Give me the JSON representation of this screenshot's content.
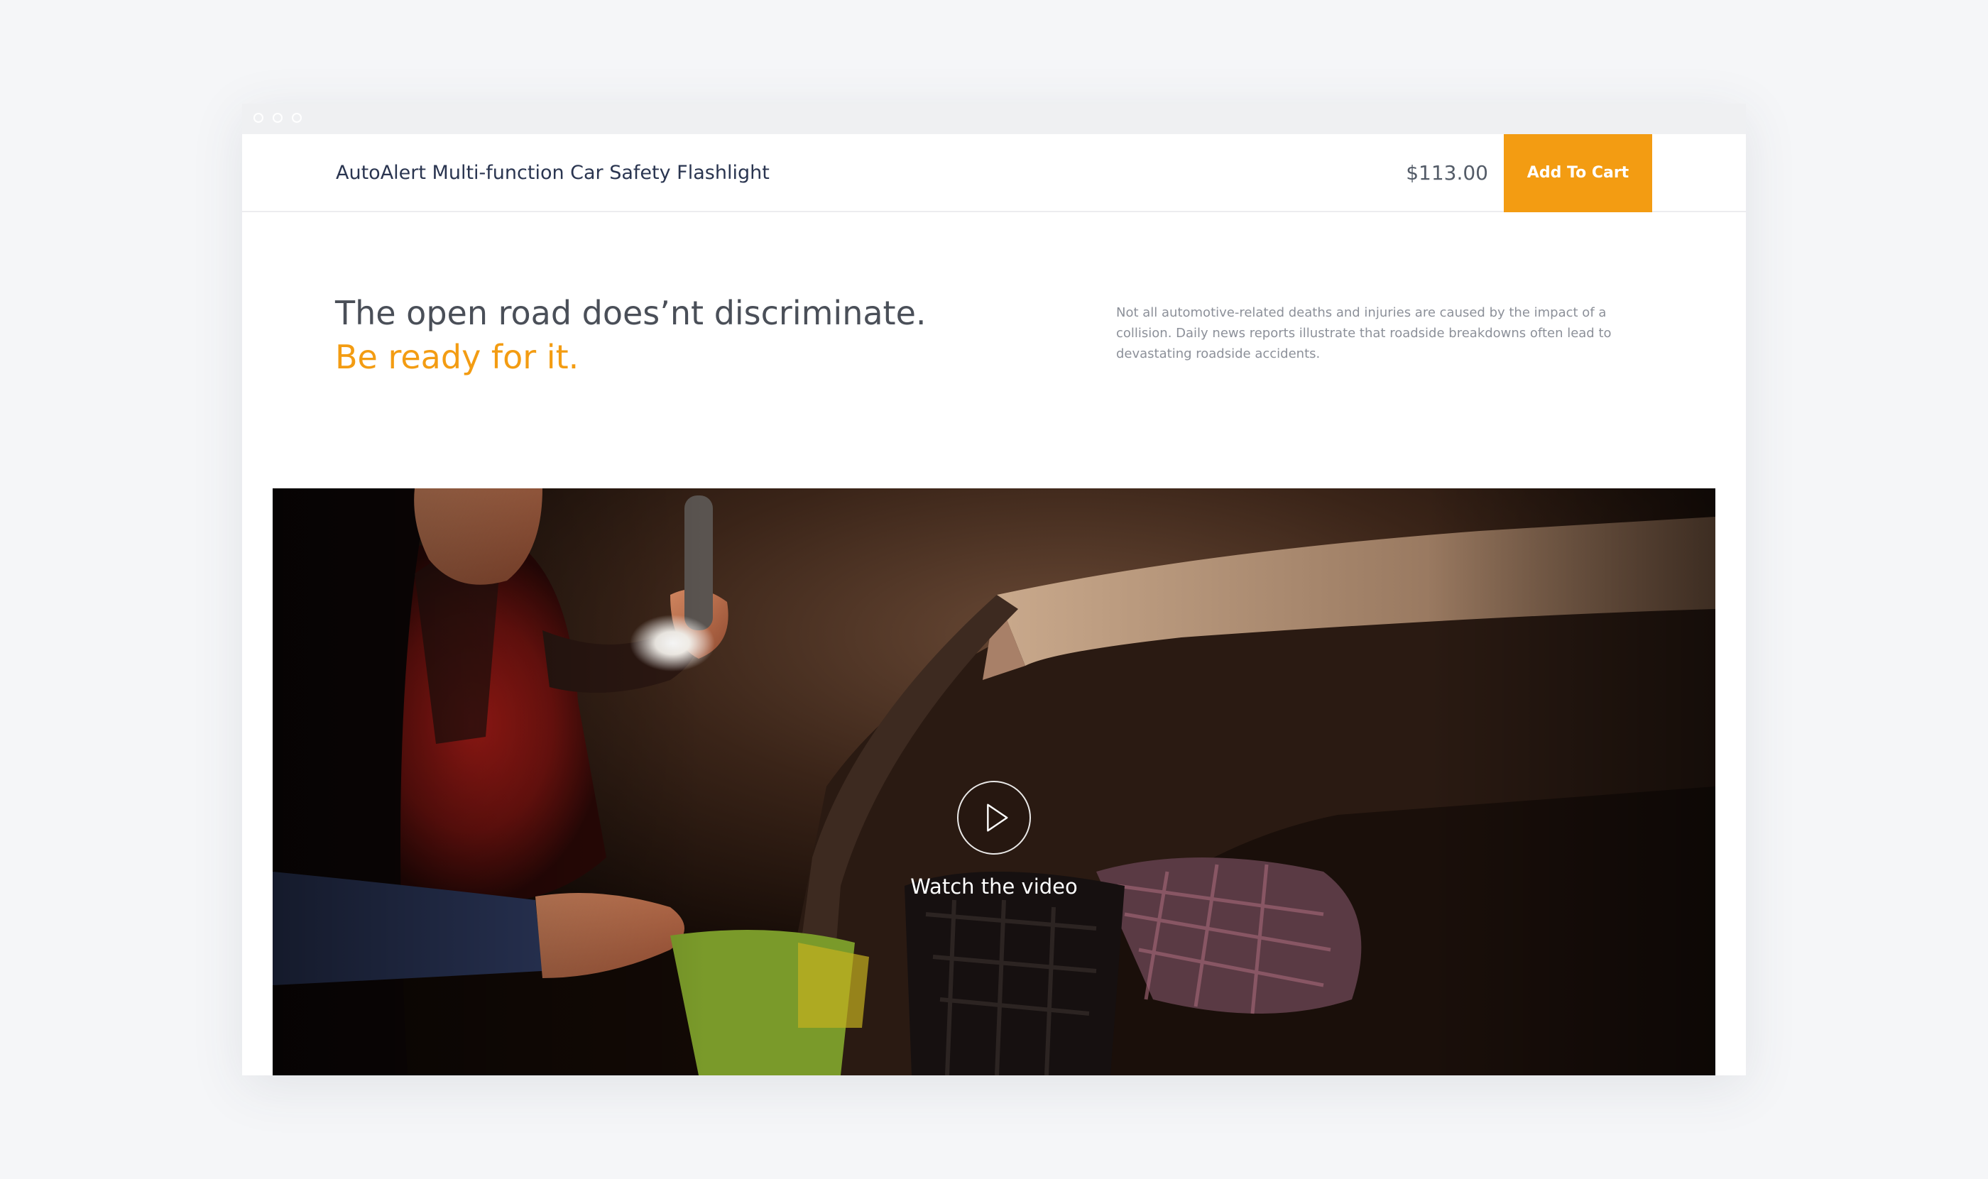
{
  "window": {
    "titlebar_dots": [
      "close",
      "minimize",
      "maximize"
    ]
  },
  "product_bar": {
    "product_name": "AutoAlert Multi-function Car Safety Flashlight",
    "price": "$113.00",
    "add_to_cart_label": "Add To Cart"
  },
  "hero": {
    "headline_line1": "The open road does’nt discriminate.",
    "headline_line2": "Be ready for it.",
    "intro_text": "Not all automotive-related deaths and injuries are caused by the impact of a collision. Daily news reports illustrate that roadside breakdowns often lead to devastating roadside accidents."
  },
  "video": {
    "play_icon": "play-icon",
    "watch_label": "Watch the video"
  },
  "colors": {
    "accent": "#f39c12",
    "page_background": "#f5f6f8",
    "product_name_text": "#2a3550",
    "headline_text": "#4a4f58",
    "body_text": "#8c9099"
  }
}
